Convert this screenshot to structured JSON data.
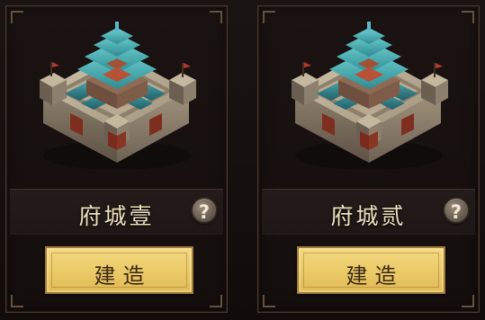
{
  "cards": [
    {
      "name": "府城壹",
      "help": "?",
      "build": "建造"
    },
    {
      "name": "府城贰",
      "help": "?",
      "build": "建造"
    }
  ],
  "colors": {
    "background": "#120d0b",
    "panel_border": "#4c3a2e",
    "title_text": "#efe0bd",
    "button_fill": "#eccd6b",
    "button_text": "#3b2714",
    "fortress_wall": "#b1a58e",
    "roof_teal": "#59bcc0"
  },
  "icons": {
    "help": "question-mark-icon"
  }
}
